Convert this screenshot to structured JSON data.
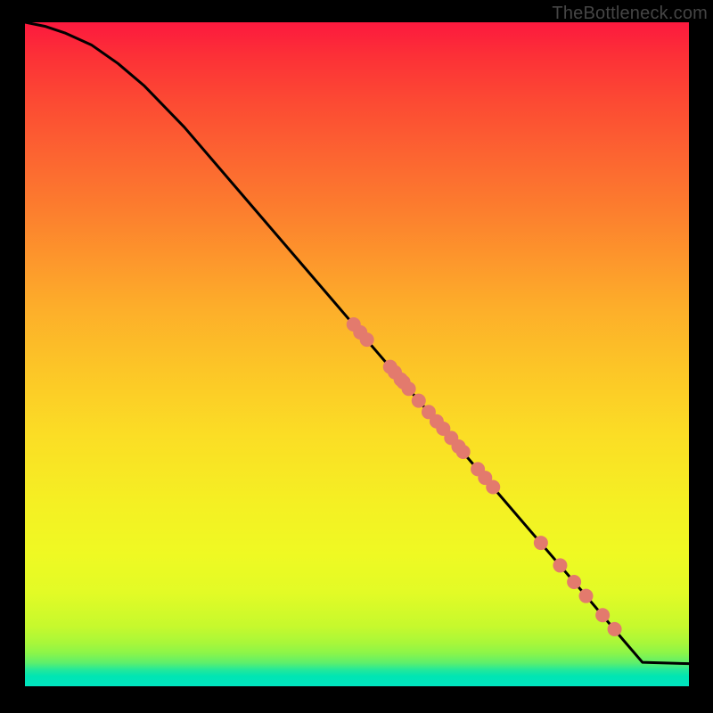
{
  "watermark": "TheBottleneck.com",
  "chart_data": {
    "type": "line",
    "title": "",
    "xlabel": "",
    "ylabel": "",
    "xlim": [
      0,
      100
    ],
    "ylim": [
      0,
      100
    ],
    "grid": false,
    "series": [
      {
        "name": "curve",
        "style": "line",
        "color": "#000000",
        "x": [
          0,
          3,
          6,
          10,
          14,
          18,
          24,
          30,
          36,
          42,
          48,
          54,
          60,
          66,
          72,
          78,
          84,
          90,
          93,
          100
        ],
        "y": [
          100,
          99.4,
          98.4,
          96.6,
          93.8,
          90.4,
          84.2,
          77.2,
          70.2,
          63.2,
          56.2,
          49.2,
          42.2,
          35.2,
          28.2,
          21.2,
          14.2,
          7.1,
          3.6,
          3.4
        ]
      },
      {
        "name": "points",
        "style": "scatter",
        "color": "#e37a6d",
        "x": [
          49.5,
          50.5,
          51.5,
          55.0,
          55.7,
          56.6,
          57.0,
          57.8,
          59.3,
          60.8,
          62.0,
          63.0,
          64.2,
          65.3,
          66.0,
          68.2,
          69.3,
          70.5,
          77.7,
          80.6,
          82.7,
          84.5,
          87.0,
          88.8
        ],
        "y": [
          54.5,
          53.3,
          52.2,
          48.1,
          47.3,
          46.2,
          45.8,
          44.8,
          43.0,
          41.3,
          39.9,
          38.8,
          37.4,
          36.1,
          35.3,
          32.7,
          31.4,
          30.0,
          21.6,
          18.2,
          15.7,
          13.6,
          10.7,
          8.6
        ]
      }
    ]
  }
}
